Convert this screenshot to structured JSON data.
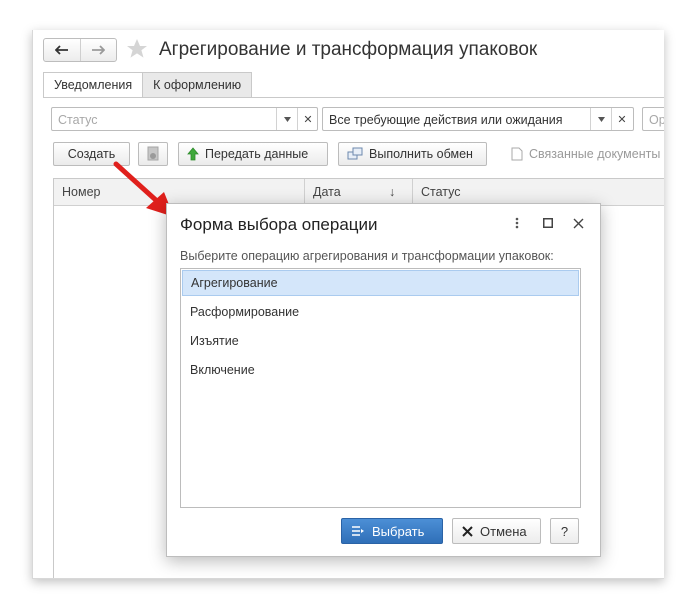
{
  "window": {
    "title": "Агрегирование и трансформация упаковок",
    "tabs": [
      {
        "label": "Уведомления",
        "active": true
      },
      {
        "label": "К оформлению",
        "active": false
      }
    ]
  },
  "filters": {
    "status_placeholder": "Статус",
    "mode_value": "Все требующие действия или ожидания",
    "org_placeholder": "Ор"
  },
  "toolbar": {
    "create_label": "Создать",
    "send_label": "Передать данные",
    "exchange_label": "Выполнить обмен",
    "related_label": "Связанные документы"
  },
  "table": {
    "columns": [
      "Номер",
      "Дата",
      "Статус"
    ],
    "sort_indicator": "↓"
  },
  "dialog": {
    "title": "Форма выбора операции",
    "prompt": "Выберите операцию агрегирования и трансформации упаковок:",
    "options": [
      {
        "label": "Агрегирование",
        "selected": true
      },
      {
        "label": "Расформирование",
        "selected": false
      },
      {
        "label": "Изъятие",
        "selected": false
      },
      {
        "label": "Включение",
        "selected": false
      }
    ],
    "select_label": "Выбрать",
    "cancel_label": "Отмена",
    "help_label": "?"
  },
  "colors": {
    "accent_arrow": "#e0201c",
    "primary_button": "#3a7cc7",
    "selection": "#d4e6fa"
  }
}
